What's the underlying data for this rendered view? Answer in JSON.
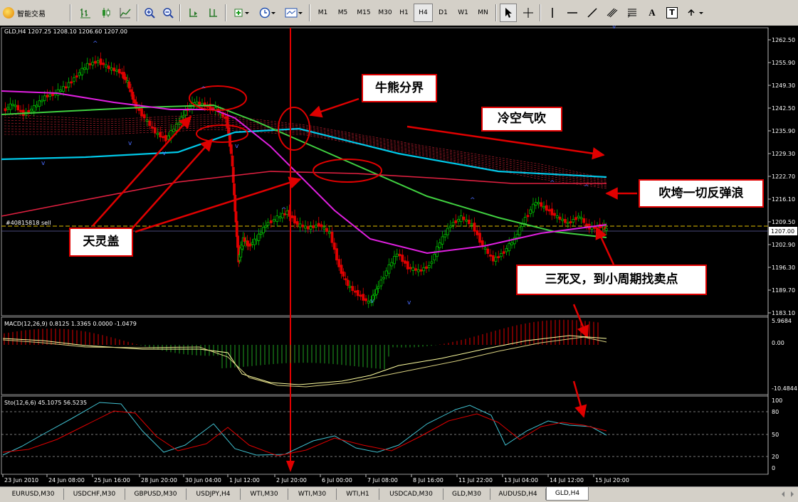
{
  "toolbar": {
    "app_title": "智能交易",
    "timeframes": [
      "M1",
      "M5",
      "M15",
      "M30",
      "H1",
      "H4",
      "D1",
      "W1",
      "MN"
    ],
    "active_timeframe": "H4",
    "drawing_text_tools": [
      "A",
      "T"
    ]
  },
  "chart": {
    "header": "GLD,H4  1207.25 1208.10 1206.60 1207.00",
    "order_label": "#40815818 sell",
    "current_price": "1207.00",
    "price_ticks": [
      "1262.50",
      "1255.90",
      "1249.30",
      "1242.50",
      "1235.90",
      "1229.30",
      "1222.70",
      "1216.10",
      "1209.50",
      "1202.90",
      "1196.30",
      "1189.70",
      "1183.10"
    ],
    "macd_header": "MACD(12,26,9) 0.8125 1.3365 0.0000 -1.0479",
    "macd_ticks": [
      "5.9684",
      "0.00",
      "-10.4844"
    ],
    "sto_header": "Sto(12,6,6) 45.1075 56.5235",
    "sto_ticks": [
      "100",
      "80",
      "50",
      "20",
      "0"
    ],
    "date_ticks": [
      "23 Jun 2010",
      "24 Jun 08:00",
      "25 Jun 16:00",
      "28 Jun 20:00",
      "30 Jun 04:00",
      "1 Jul 12:00",
      "2 Jul 20:00",
      "6 Jul 00:00",
      "7 Jul 08:00",
      "8 Jul 16:00",
      "11 Jul 22:00",
      "13 Jul 04:00",
      "14 Jul 12:00",
      "15 Jul 20:00"
    ]
  },
  "annotations": {
    "bull_bear": "牛熊分界",
    "cold_air": "冷空气吹",
    "blow_rebound": "吹垮一切反弹浪",
    "tian_ling_gai": "天灵盖",
    "triple_death": "三死叉，到小周期找卖点"
  },
  "colors": {
    "background": "#000000",
    "bull_candle": "#00c000",
    "bear_candle": "#e00000",
    "ma_cyan": "#00c8e8",
    "ma_green": "#40d040",
    "ma_magenta": "#e020e0",
    "ma_red": "#e02040",
    "annotation_border": "#e00000",
    "macd_line": "#ffffa0",
    "sto_main": "#40c0d0",
    "sto_signal": "#e00000"
  },
  "tabs": [
    {
      "label": "EURUSD,M30"
    },
    {
      "label": "USDCHF,M30"
    },
    {
      "label": "GBPUSD,M30"
    },
    {
      "label": "USDJPY,H4"
    },
    {
      "label": "WTI,M30"
    },
    {
      "label": "WTI,M30"
    },
    {
      "label": "WTI,H1"
    },
    {
      "label": "USDCAD,M30"
    },
    {
      "label": "GLD,M30"
    },
    {
      "label": "AUDUSD,H4"
    },
    {
      "label": "GLD,H4",
      "active": true
    }
  ]
}
